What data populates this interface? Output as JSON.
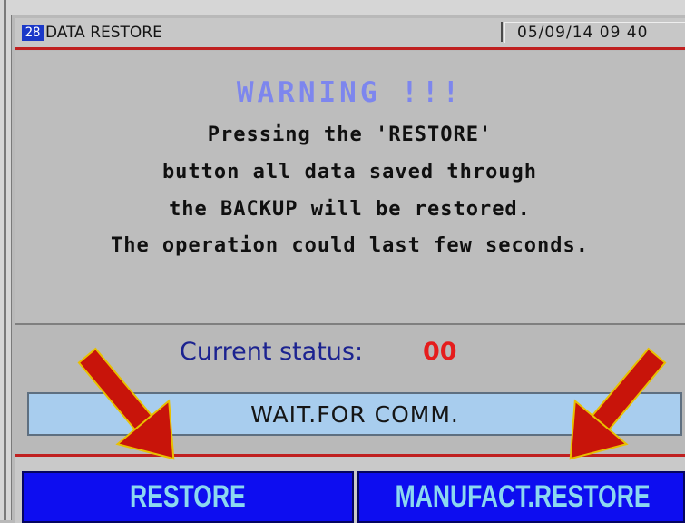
{
  "header": {
    "screen_number": "28",
    "screen_title": "DATA RESTORE",
    "date_time": "05/09/14  09 40"
  },
  "warning": {
    "title": "WARNING !!!",
    "lines": [
      "Pressing the 'RESTORE'",
      "button all data saved through",
      "the BACKUP will be restored.",
      "The operation could last few seconds."
    ]
  },
  "status": {
    "label": "Current status:",
    "value": "00"
  },
  "communication": {
    "message": "WAIT.FOR COMM."
  },
  "buttons": {
    "restore_label": "RESTORE",
    "manufact_restore_label": "MANUFACT.RESTORE"
  },
  "colors": {
    "warning_title": "#7d86ee",
    "status_value": "#e51c1c",
    "button_bg": "#0d0df0",
    "button_text": "#8bd8f0",
    "comm_bar": "#a8cdee",
    "annotation_arrow": "#c8140a"
  },
  "annotations": {
    "arrow_icon": "red-arrow-pointing-down"
  }
}
